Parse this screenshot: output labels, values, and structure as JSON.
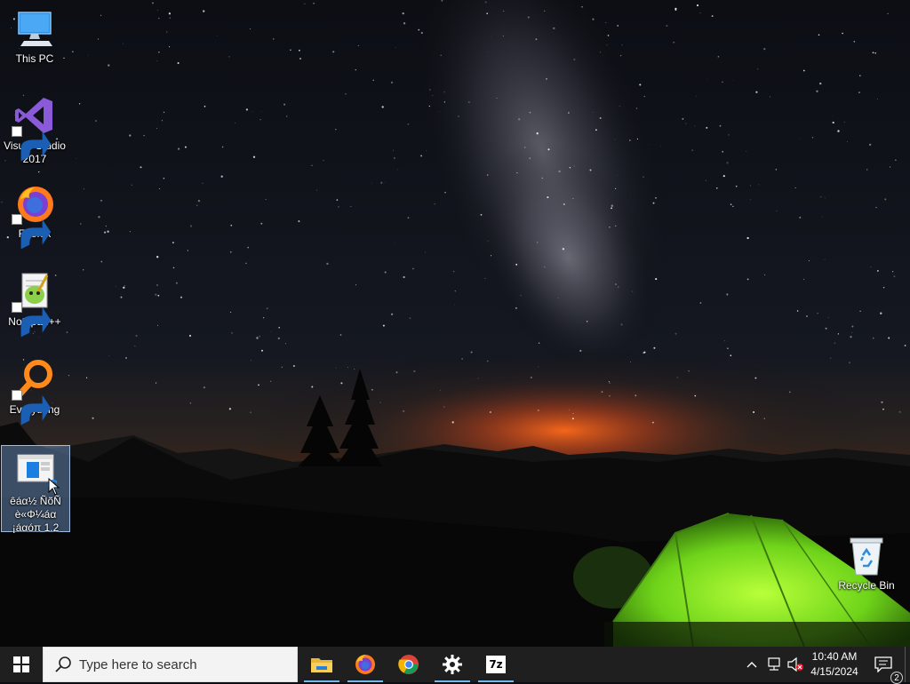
{
  "desktop": {
    "icons": [
      {
        "label": "This PC",
        "icon": "this-pc-icon"
      },
      {
        "label": "Visual Studio\n2017",
        "icon": "visual-studio-icon"
      },
      {
        "label": "Firefox",
        "icon": "firefox-icon"
      },
      {
        "label": "Notepad++",
        "icon": "notepad-plus-plus-icon"
      },
      {
        "label": "Everything",
        "icon": "everything-icon"
      },
      {
        "label": "êáα½ ÑõÑ\nè«Φ¼áα\n¡áαóπ 1.2",
        "icon": "installer-icon",
        "selected": true
      },
      {
        "label": "Recycle Bin",
        "icon": "recycle-bin-icon"
      }
    ]
  },
  "taskbar": {
    "start_icon": "windows-logo-icon",
    "search_placeholder": "Type here to search",
    "pinned_apps": [
      {
        "name": "File Explorer",
        "icon": "file-explorer-icon",
        "running": true
      },
      {
        "name": "Firefox",
        "icon": "firefox-icon",
        "running": true
      },
      {
        "name": "Google Chrome",
        "icon": "chrome-icon",
        "running": false
      },
      {
        "name": "Settings",
        "icon": "gear-icon",
        "running": true
      },
      {
        "name": "7-Zip",
        "icon": "7zip-icon",
        "running": true
      }
    ],
    "seven_zip_label": "7z",
    "tray": {
      "overflow_icon": "chevron-up-icon",
      "network_icon": "network-icon",
      "volume_icon": "volume-muted-icon"
    },
    "clock": {
      "time": "10:40 AM",
      "date": "4/15/2024"
    },
    "notifications": {
      "icon": "action-center-icon",
      "count": "2"
    }
  },
  "colors": {
    "taskbar": "#1f1f1f",
    "search_box": "#f3f3f3",
    "running_indicator": "#76b9ed",
    "selection": "#78a0d2"
  }
}
